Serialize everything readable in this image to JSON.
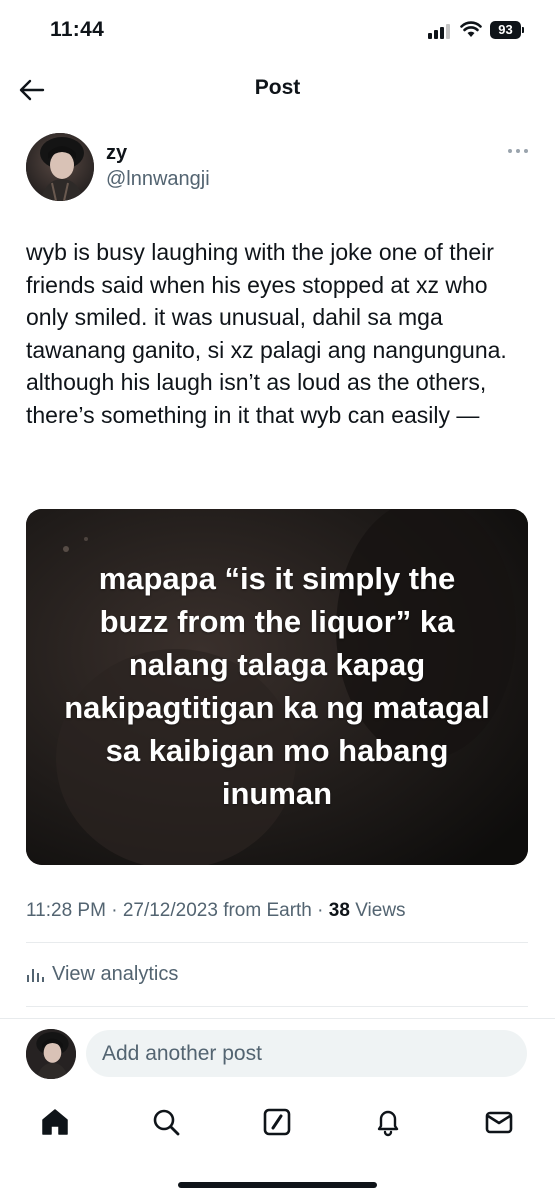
{
  "status_bar": {
    "time": "11:44",
    "battery": "93"
  },
  "header": {
    "title": "Post"
  },
  "author": {
    "display_name": "zy",
    "handle": "@lnnwangji"
  },
  "post": {
    "text": "wyb is busy laughing with the joke one of their friends said when his eyes stopped at xz who only smiled. it was unusual, dahil sa mga tawanang ganito, si xz palagi ang nangunguna. although his laugh isn’t as loud as the others, there’s something in it that wyb can easily —",
    "media_caption": "mapapa “is it simply the buzz from the liquor” ka nalang talaga kapag nakipagtitigan ka ng matagal sa kaibigan mo habang inuman",
    "time": "11:28 PM",
    "date": "27/12/2023",
    "source": "from Earth",
    "views_count": "38",
    "views_label": "Views",
    "analytics_label": "View analytics"
  },
  "reply": {
    "placeholder": "Add another post"
  },
  "nav": {
    "icons": [
      "home-icon",
      "search-icon",
      "compose-icon",
      "notifications-icon",
      "messages-icon"
    ]
  },
  "colors": {
    "text": "#0f1419",
    "secondary": "#536471",
    "divider": "#e8ebed",
    "input_bg": "#eff3f4"
  }
}
